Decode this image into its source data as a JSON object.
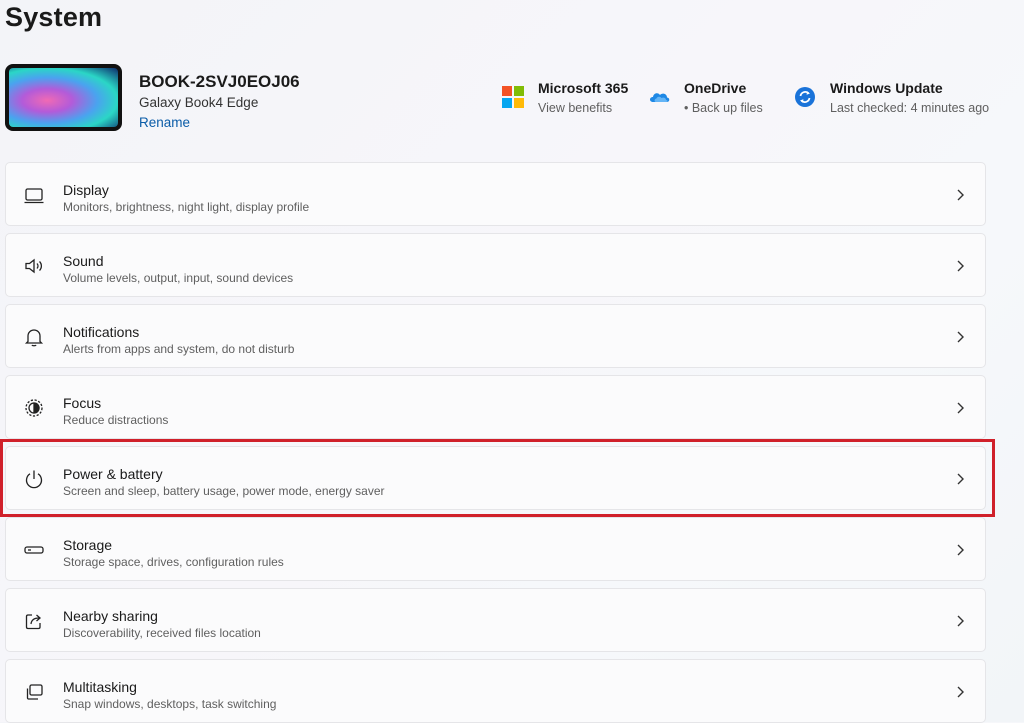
{
  "page": {
    "title": "System"
  },
  "device": {
    "name": "BOOK-2SVJ0EOJ06",
    "model": "Galaxy Book4 Edge",
    "rename_label": "Rename"
  },
  "quick_links": [
    {
      "title": "Microsoft 365",
      "subtitle": "View benefits",
      "icon": "microsoft-365-icon"
    },
    {
      "title": "OneDrive",
      "subtitle": "• Back up files",
      "icon": "onedrive-icon"
    },
    {
      "title": "Windows Update",
      "subtitle": "Last checked: 4 minutes ago",
      "icon": "windows-update-icon"
    }
  ],
  "settings": [
    {
      "title": "Display",
      "subtitle": "Monitors, brightness, night light, display profile",
      "icon": "display-icon"
    },
    {
      "title": "Sound",
      "subtitle": "Volume levels, output, input, sound devices",
      "icon": "sound-icon"
    },
    {
      "title": "Notifications",
      "subtitle": "Alerts from apps and system, do not disturb",
      "icon": "bell-icon"
    },
    {
      "title": "Focus",
      "subtitle": "Reduce distractions",
      "icon": "focus-icon"
    },
    {
      "title": "Power & battery",
      "subtitle": "Screen and sleep, battery usage, power mode, energy saver",
      "icon": "power-icon"
    },
    {
      "title": "Storage",
      "subtitle": "Storage space, drives, configuration rules",
      "icon": "storage-icon"
    },
    {
      "title": "Nearby sharing",
      "subtitle": "Discoverability, received files location",
      "icon": "share-icon"
    },
    {
      "title": "Multitasking",
      "subtitle": "Snap windows, desktops, task switching",
      "icon": "multitasking-icon"
    }
  ],
  "colors": {
    "highlight": "#d0202a",
    "link": "#0a5ca8"
  }
}
